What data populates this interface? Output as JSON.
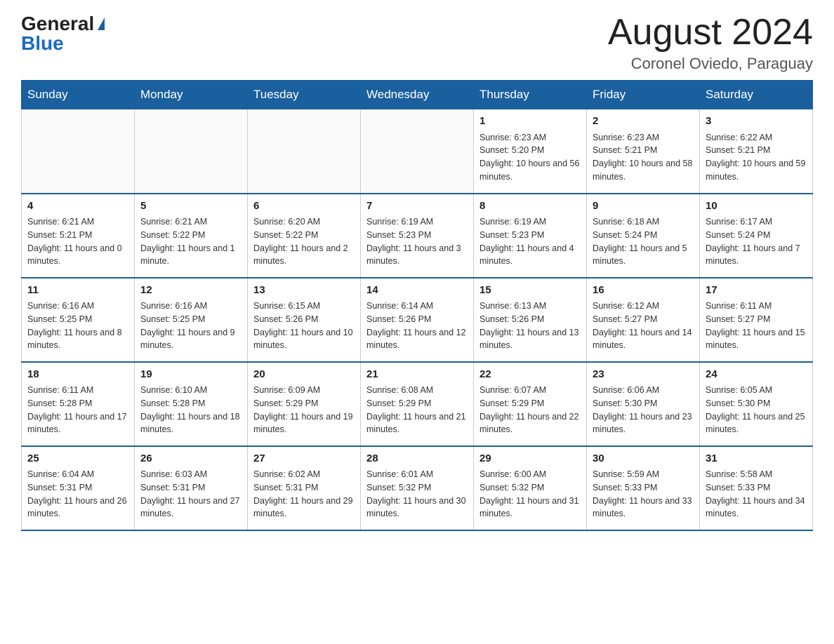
{
  "header": {
    "logo_general": "General",
    "logo_blue": "Blue",
    "title": "August 2024",
    "location": "Coronel Oviedo, Paraguay"
  },
  "days_of_week": [
    "Sunday",
    "Monday",
    "Tuesday",
    "Wednesday",
    "Thursday",
    "Friday",
    "Saturday"
  ],
  "weeks": [
    [
      {
        "day": "",
        "info": ""
      },
      {
        "day": "",
        "info": ""
      },
      {
        "day": "",
        "info": ""
      },
      {
        "day": "",
        "info": ""
      },
      {
        "day": "1",
        "info": "Sunrise: 6:23 AM\nSunset: 5:20 PM\nDaylight: 10 hours and 56 minutes."
      },
      {
        "day": "2",
        "info": "Sunrise: 6:23 AM\nSunset: 5:21 PM\nDaylight: 10 hours and 58 minutes."
      },
      {
        "day": "3",
        "info": "Sunrise: 6:22 AM\nSunset: 5:21 PM\nDaylight: 10 hours and 59 minutes."
      }
    ],
    [
      {
        "day": "4",
        "info": "Sunrise: 6:21 AM\nSunset: 5:21 PM\nDaylight: 11 hours and 0 minutes."
      },
      {
        "day": "5",
        "info": "Sunrise: 6:21 AM\nSunset: 5:22 PM\nDaylight: 11 hours and 1 minute."
      },
      {
        "day": "6",
        "info": "Sunrise: 6:20 AM\nSunset: 5:22 PM\nDaylight: 11 hours and 2 minutes."
      },
      {
        "day": "7",
        "info": "Sunrise: 6:19 AM\nSunset: 5:23 PM\nDaylight: 11 hours and 3 minutes."
      },
      {
        "day": "8",
        "info": "Sunrise: 6:19 AM\nSunset: 5:23 PM\nDaylight: 11 hours and 4 minutes."
      },
      {
        "day": "9",
        "info": "Sunrise: 6:18 AM\nSunset: 5:24 PM\nDaylight: 11 hours and 5 minutes."
      },
      {
        "day": "10",
        "info": "Sunrise: 6:17 AM\nSunset: 5:24 PM\nDaylight: 11 hours and 7 minutes."
      }
    ],
    [
      {
        "day": "11",
        "info": "Sunrise: 6:16 AM\nSunset: 5:25 PM\nDaylight: 11 hours and 8 minutes."
      },
      {
        "day": "12",
        "info": "Sunrise: 6:16 AM\nSunset: 5:25 PM\nDaylight: 11 hours and 9 minutes."
      },
      {
        "day": "13",
        "info": "Sunrise: 6:15 AM\nSunset: 5:26 PM\nDaylight: 11 hours and 10 minutes."
      },
      {
        "day": "14",
        "info": "Sunrise: 6:14 AM\nSunset: 5:26 PM\nDaylight: 11 hours and 12 minutes."
      },
      {
        "day": "15",
        "info": "Sunrise: 6:13 AM\nSunset: 5:26 PM\nDaylight: 11 hours and 13 minutes."
      },
      {
        "day": "16",
        "info": "Sunrise: 6:12 AM\nSunset: 5:27 PM\nDaylight: 11 hours and 14 minutes."
      },
      {
        "day": "17",
        "info": "Sunrise: 6:11 AM\nSunset: 5:27 PM\nDaylight: 11 hours and 15 minutes."
      }
    ],
    [
      {
        "day": "18",
        "info": "Sunrise: 6:11 AM\nSunset: 5:28 PM\nDaylight: 11 hours and 17 minutes."
      },
      {
        "day": "19",
        "info": "Sunrise: 6:10 AM\nSunset: 5:28 PM\nDaylight: 11 hours and 18 minutes."
      },
      {
        "day": "20",
        "info": "Sunrise: 6:09 AM\nSunset: 5:29 PM\nDaylight: 11 hours and 19 minutes."
      },
      {
        "day": "21",
        "info": "Sunrise: 6:08 AM\nSunset: 5:29 PM\nDaylight: 11 hours and 21 minutes."
      },
      {
        "day": "22",
        "info": "Sunrise: 6:07 AM\nSunset: 5:29 PM\nDaylight: 11 hours and 22 minutes."
      },
      {
        "day": "23",
        "info": "Sunrise: 6:06 AM\nSunset: 5:30 PM\nDaylight: 11 hours and 23 minutes."
      },
      {
        "day": "24",
        "info": "Sunrise: 6:05 AM\nSunset: 5:30 PM\nDaylight: 11 hours and 25 minutes."
      }
    ],
    [
      {
        "day": "25",
        "info": "Sunrise: 6:04 AM\nSunset: 5:31 PM\nDaylight: 11 hours and 26 minutes."
      },
      {
        "day": "26",
        "info": "Sunrise: 6:03 AM\nSunset: 5:31 PM\nDaylight: 11 hours and 27 minutes."
      },
      {
        "day": "27",
        "info": "Sunrise: 6:02 AM\nSunset: 5:31 PM\nDaylight: 11 hours and 29 minutes."
      },
      {
        "day": "28",
        "info": "Sunrise: 6:01 AM\nSunset: 5:32 PM\nDaylight: 11 hours and 30 minutes."
      },
      {
        "day": "29",
        "info": "Sunrise: 6:00 AM\nSunset: 5:32 PM\nDaylight: 11 hours and 31 minutes."
      },
      {
        "day": "30",
        "info": "Sunrise: 5:59 AM\nSunset: 5:33 PM\nDaylight: 11 hours and 33 minutes."
      },
      {
        "day": "31",
        "info": "Sunrise: 5:58 AM\nSunset: 5:33 PM\nDaylight: 11 hours and 34 minutes."
      }
    ]
  ]
}
